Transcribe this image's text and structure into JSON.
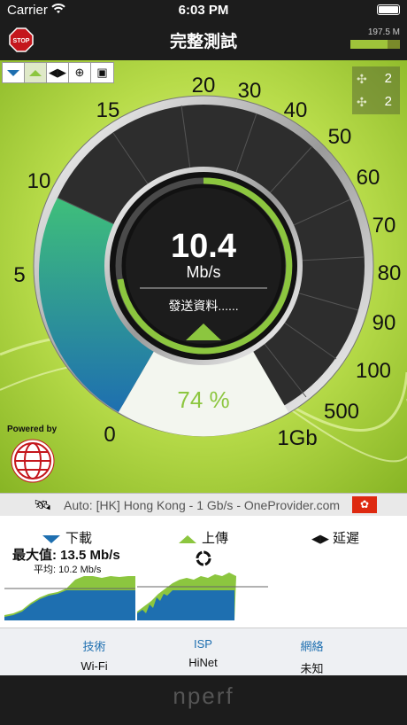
{
  "status_bar": {
    "carrier": "Carrier",
    "time": "6:03 PM"
  },
  "nav": {
    "title": "完整測試",
    "memory": "197.5 M"
  },
  "gauge_tabs": [
    "download-tab",
    "upload-tab",
    "latency-tab",
    "web-tab",
    "video-tab"
  ],
  "servers": {
    "count_a": "2",
    "count_b": "2"
  },
  "scale_labels": [
    "0",
    "5",
    "10",
    "15",
    "20",
    "30",
    "40",
    "50",
    "60",
    "70",
    "80",
    "90",
    "100",
    "500",
    "1Gb"
  ],
  "gauge": {
    "speed": "10.4",
    "unit": "Mb/s",
    "status": "發送資料......",
    "progress": "74 %",
    "progress_fraction": 0.74
  },
  "powered_by": "Powered by",
  "server": {
    "text": "Auto: [HK] Hong Kong - 1 Gb/s - OneProvider.com"
  },
  "results": {
    "download_label": "下載",
    "upload_label": "上傳",
    "latency_label": "延遲",
    "max_label": "最大值: 13.5 Mb/s",
    "avg_label": "平均: 10.2 Mb/s"
  },
  "info": {
    "tech_label": "技術",
    "tech_value": "Wi-Fi",
    "isp_label": "ISP",
    "isp_value": "HiNet",
    "network_label": "網絡",
    "network_value": "未知"
  },
  "footer": {
    "logo": "nperf"
  },
  "colors": {
    "accent_green": "#8cc63f",
    "accent_blue": "#1e6fb0",
    "background_dark": "#1c1c1c"
  }
}
